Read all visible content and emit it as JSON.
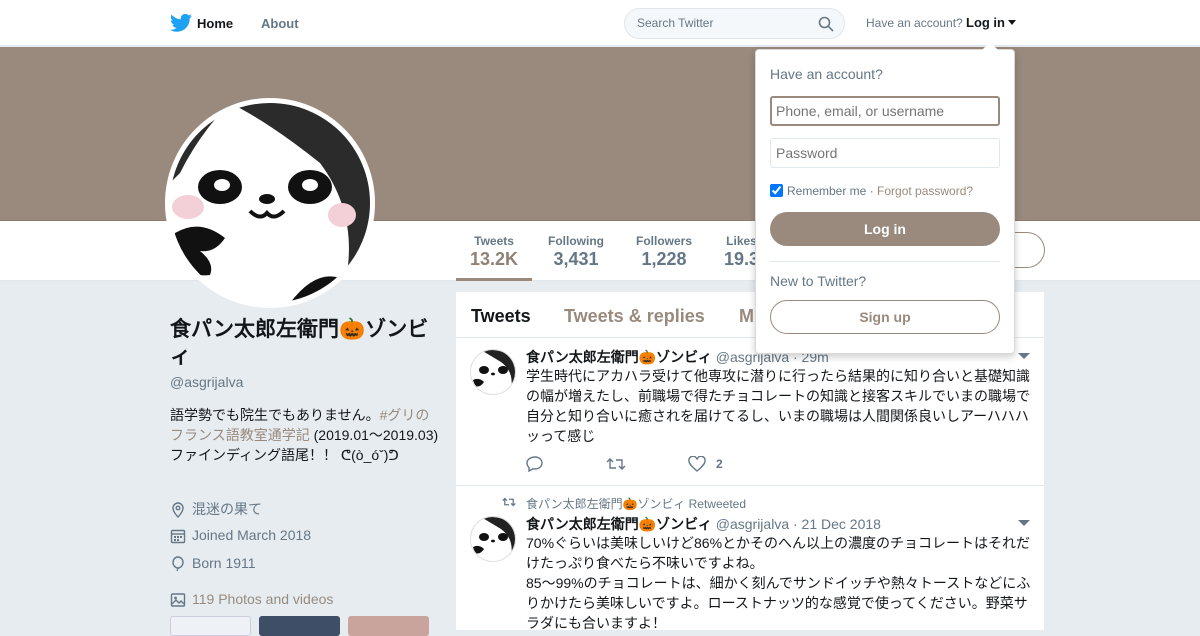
{
  "topbar": {
    "home_label": "Home",
    "about_label": "About",
    "search_placeholder": "Search Twitter",
    "have_account": "Have an account?",
    "login_label": "Log in"
  },
  "stats": [
    {
      "label": "Tweets",
      "value": "13.2K"
    },
    {
      "label": "Following",
      "value": "3,431"
    },
    {
      "label": "Followers",
      "value": "1,228"
    },
    {
      "label": "Likes",
      "value": "19.3"
    }
  ],
  "profile": {
    "name": "食パン太郎左衛門🎃ゾンビィ",
    "handle": "@asgrijalva",
    "bio_prefix": "語学勢でも院生でもありません。",
    "bio_tag": "#グリのフランス語教室通学記",
    "bio_suffix": " (2019.01〜2019.03) ファインディング語尾！！ ᕦ(ò_óˇ)ᕤ",
    "location": "混迷の果て",
    "joined": "Joined March 2018",
    "born": "Born 1911",
    "photos": "119 Photos and videos"
  },
  "tabs": [
    {
      "label": "Tweets"
    },
    {
      "label": "Tweets & replies"
    },
    {
      "label": "M"
    }
  ],
  "tweets": [
    {
      "name": "食パン太郎左衛門🎃ゾンビィ",
      "handle": "@asgrijalva",
      "date": "· 29m",
      "text": "学生時代にアカハラ受けて他専攻に潜りに行ったら結果的に知り合いと基礎知識の幅が増えたし、前職場で得たチョコレートの知識と接客スキルでいまの職場で自分と知り合いに癒されを届けてるし、いまの職場は人間関係良いしアーハハハッって感じ",
      "likes": "2"
    },
    {
      "retweet_note": "食パン太郎左衛門🎃ゾンビィ Retweeted",
      "name": "食パン太郎左衛門🎃ゾンビィ",
      "handle": "@asgrijalva",
      "date": "· 21 Dec 2018",
      "text_line1": "70%ぐらいは美味しいけど86%とかそのへん以上の濃度のチョコレートはそれだけたっぷり食べたら不味いですよね。",
      "text_line2": "85〜99%のチョコレートは、細かく刻んでサンドイッチや熱々トーストなどにふりかけたら美味しいですよ。ローストナッツ的な感覚で使ってください。野菜サラダにも合いますよ！"
    }
  ],
  "login_dropdown": {
    "title": "Have an account?",
    "username_placeholder": "Phone, email, or username",
    "password_placeholder": "Password",
    "remember": "Remember me",
    "forgot": "Forgot password?",
    "login_button": "Log in",
    "new_to": "New to Twitter?",
    "signup_button": "Sign up"
  },
  "colors": {
    "theme": "#998a7d",
    "twitter_blue": "#1da1f2"
  }
}
